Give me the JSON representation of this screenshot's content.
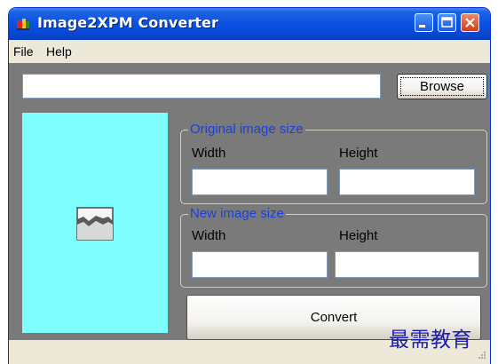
{
  "window": {
    "title": "Image2XPM Converter",
    "icon": "paint-app-icon"
  },
  "title_buttons": {
    "minimize_icon": "minimize-icon",
    "maximize_icon": "maximize-icon",
    "close_icon": "close-icon"
  },
  "menu": {
    "items": [
      {
        "label": "File"
      },
      {
        "label": "Help"
      }
    ]
  },
  "file_path": {
    "value": "",
    "placeholder": ""
  },
  "browse_button": {
    "label": "Browse"
  },
  "preview": {
    "background": "#80ffff",
    "icon": "image-placeholder-icon"
  },
  "original_size": {
    "legend": "Original image size",
    "width_label": "Width",
    "height_label": "Height",
    "width_value": "",
    "height_value": ""
  },
  "new_size": {
    "legend": "New image size",
    "width_label": "Width",
    "height_label": "Height",
    "width_value": "",
    "height_value": ""
  },
  "convert_button": {
    "label": "Convert"
  },
  "watermark": {
    "text": "最需教育"
  },
  "colors": {
    "titlebar": "#0a54e3",
    "client_background": "#7a7a7a",
    "legend_text": "#1a3fde",
    "preview_background": "#80ffff",
    "watermark": "#1a1ab5"
  }
}
